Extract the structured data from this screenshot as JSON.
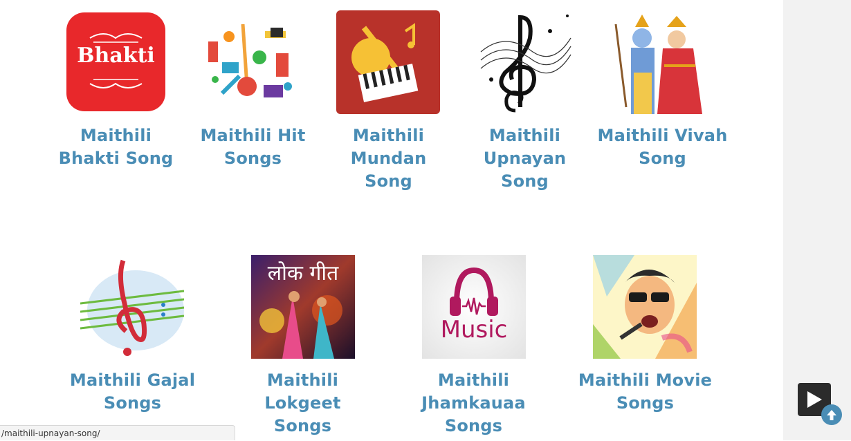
{
  "songs": [
    {
      "label_line1": "Maithili",
      "label_line2": "Bhakti Song",
      "thumb_text": "Bhakti",
      "icon": "bhakti-icon"
    },
    {
      "label_line1": "Maithili Hit",
      "label_line2": "Songs",
      "icon": "instruments-collage-icon"
    },
    {
      "label_line1": "Maithili",
      "label_line2": "Mundan",
      "label_line3": "Song",
      "icon": "guitar-piano-icon"
    },
    {
      "label_line1": "Maithili",
      "label_line2": "Upnayan",
      "label_line3": "Song",
      "icon": "treble-clef-icon"
    },
    {
      "label_line1": "Maithili Vivah",
      "label_line2": "Song",
      "icon": "ram-sita-icon"
    },
    {
      "label_line1": "Maithili Gajal",
      "label_line2": "Songs",
      "icon": "music-clef-icon"
    },
    {
      "label_line1": "Maithili Lokgeet",
      "label_line2": "Songs",
      "thumb_text": "लोक गीत",
      "icon": "lokgeet-dance-icon"
    },
    {
      "label_line1": "Maithili",
      "label_line2": "Jhamkauaa",
      "label_line3": "Songs",
      "thumb_text": "Music",
      "icon": "headphones-music-icon"
    },
    {
      "label_line1": "Maithili Movie",
      "label_line2": "Songs",
      "icon": "singer-portrait-icon"
    }
  ],
  "status_url": "/maithili-upnayan-song/",
  "controls": {
    "play_icon": "play-icon",
    "scroll_top_icon": "arrow-up-icon"
  },
  "colors": {
    "link": "#4a8db5",
    "bhakti_red": "#e8282b",
    "mundan_red": "#b8322a",
    "music_pink": "#b0195e"
  }
}
